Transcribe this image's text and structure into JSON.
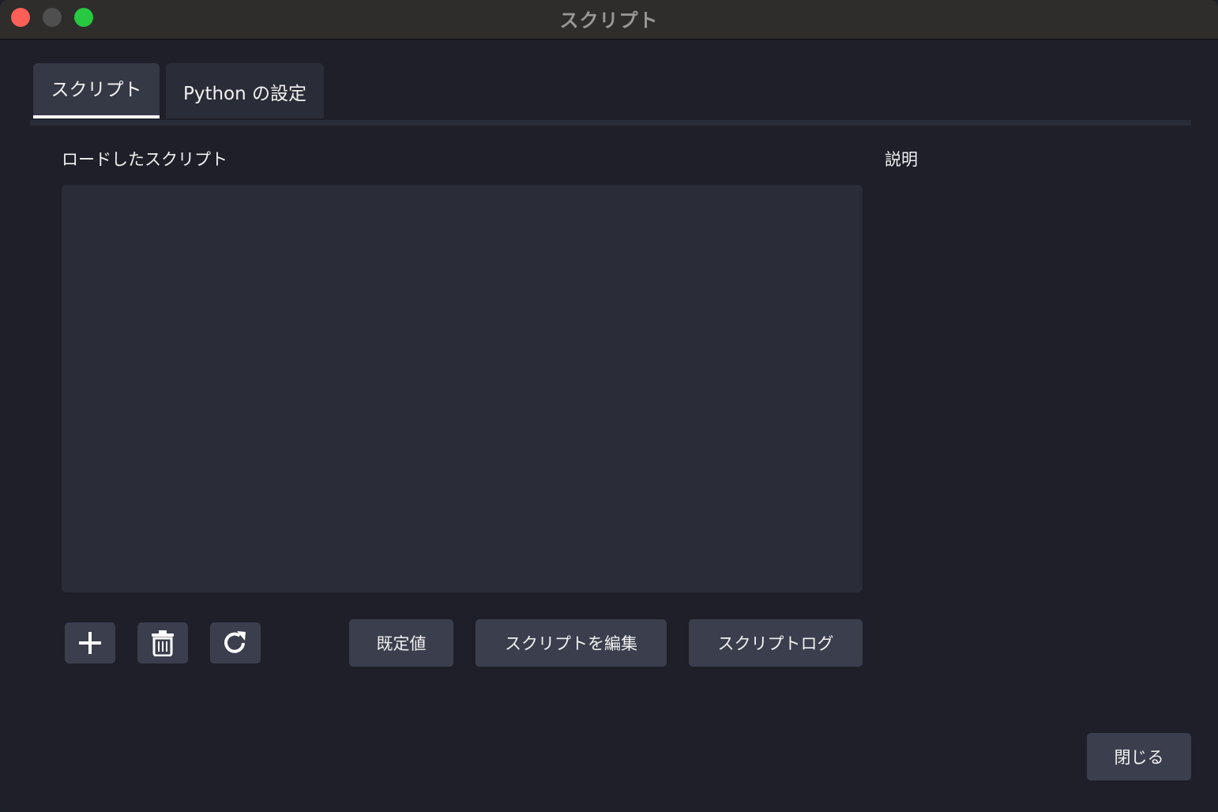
{
  "window": {
    "title": "スクリプト"
  },
  "tabs": [
    {
      "label": "スクリプト",
      "active": true
    },
    {
      "label": "Python の設定",
      "active": false
    }
  ],
  "main": {
    "loaded_scripts_label": "ロードしたスクリプト",
    "description_label": "説明",
    "scripts": []
  },
  "toolbar": {
    "add_icon": "plus-icon",
    "remove_icon": "trash-icon",
    "reload_icon": "reload-icon",
    "defaults_label": "既定値",
    "edit_label": "スクリプトを編集",
    "log_label": "スクリプトログ"
  },
  "footer": {
    "close_label": "閉じる"
  },
  "colors": {
    "background": "#1e1f28",
    "panel": "#2a2c38",
    "button": "#3b3e4c",
    "close_light": "#fe5f57",
    "minimize_light": "#4f4f50",
    "maximize_light": "#28c840"
  }
}
